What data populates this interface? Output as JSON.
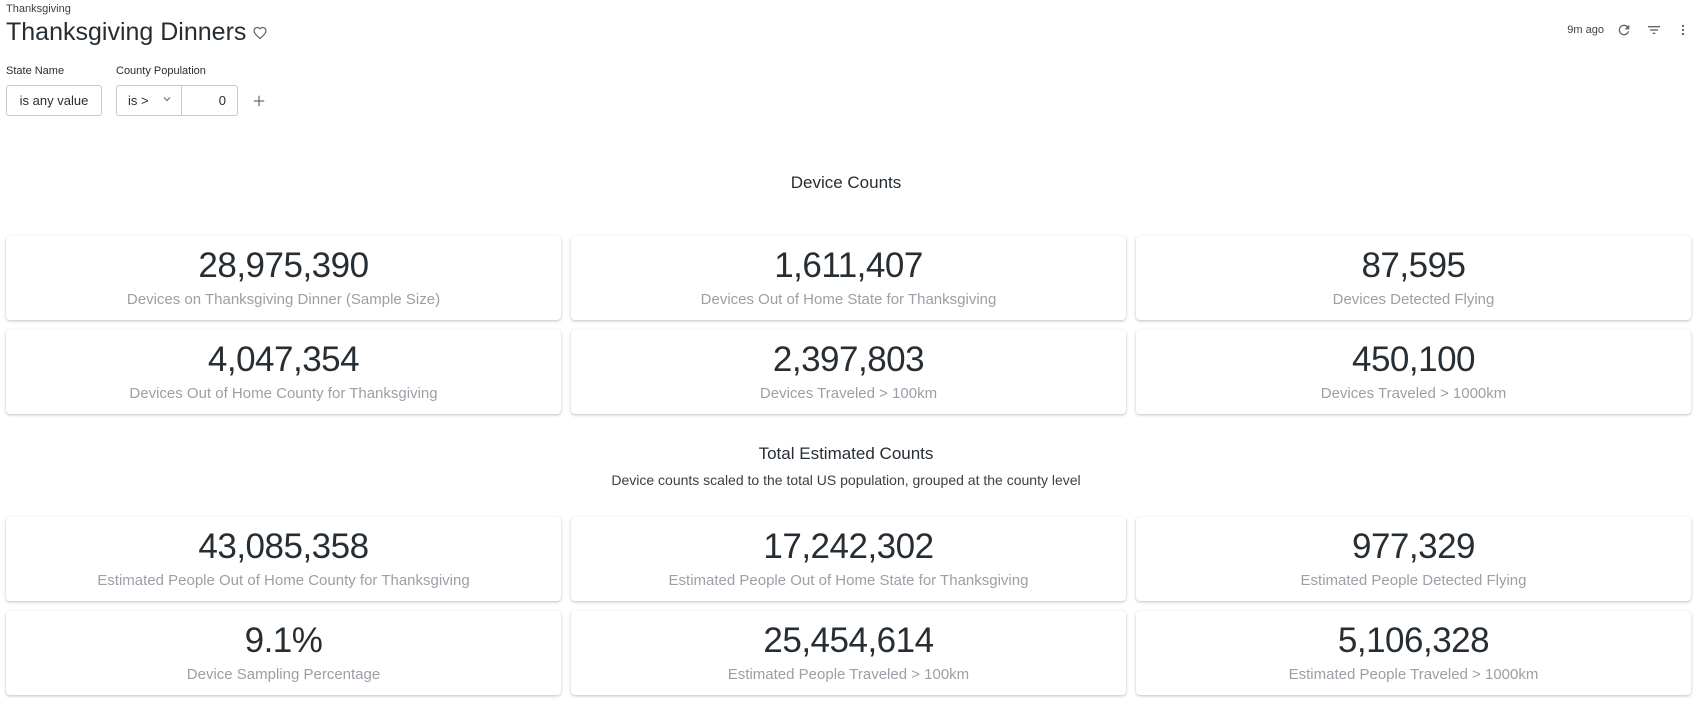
{
  "breadcrumb": "Thanksgiving",
  "dashboard": {
    "title": "Thanksgiving Dinners",
    "updated": "9m ago"
  },
  "icons": {
    "favorite": "heart-outline-icon",
    "refresh": "refresh-icon",
    "filter": "filter-icon",
    "more": "more-vert-icon",
    "add": "plus-icon",
    "chevron": "chevron-down-icon"
  },
  "filters": {
    "state": {
      "label": "State Name",
      "value": "is any value"
    },
    "county": {
      "label": "County Population",
      "operator": "is >",
      "value": "0"
    }
  },
  "sections": {
    "device": {
      "title": "Device Counts"
    },
    "estimated": {
      "title": "Total Estimated Counts",
      "subtitle": "Device counts scaled to the total US population, grouped at the county level"
    }
  },
  "device_tiles": [
    {
      "value": "28,975,390",
      "label": "Devices on Thanksgiving Dinner (Sample Size)"
    },
    {
      "value": "1,611,407",
      "label": "Devices Out of Home State for Thanksgiving"
    },
    {
      "value": "87,595",
      "label": "Devices Detected Flying"
    },
    {
      "value": "4,047,354",
      "label": "Devices Out of Home County for Thanksgiving"
    },
    {
      "value": "2,397,803",
      "label": "Devices Traveled > 100km"
    },
    {
      "value": "450,100",
      "label": "Devices Traveled > 1000km"
    }
  ],
  "estimated_tiles": [
    {
      "value": "43,085,358",
      "label": "Estimated People Out of Home County for Thanksgiving"
    },
    {
      "value": "17,242,302",
      "label": "Estimated People Out of Home State for Thanksgiving"
    },
    {
      "value": "977,329",
      "label": "Estimated People Detected Flying"
    },
    {
      "value": "9.1%",
      "label": "Device Sampling Percentage"
    },
    {
      "value": "25,454,614",
      "label": "Estimated People Traveled > 100km"
    },
    {
      "value": "5,106,328",
      "label": "Estimated People Traveled > 1000km"
    }
  ]
}
